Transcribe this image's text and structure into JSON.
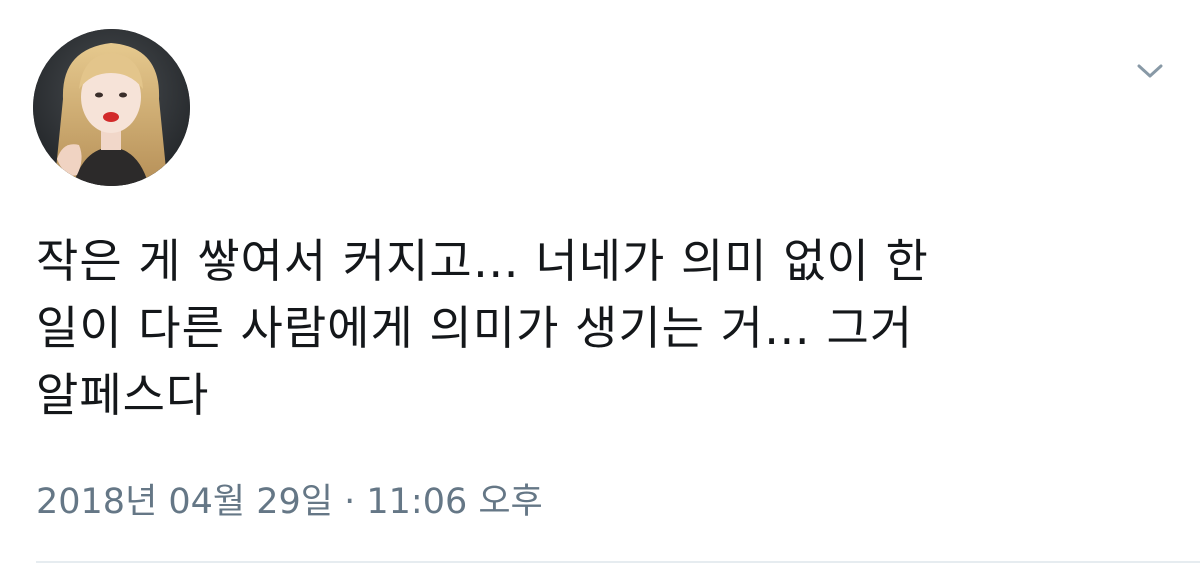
{
  "tweet": {
    "avatar_icon": "user-avatar",
    "menu_icon": "chevron-down-icon",
    "text": "작은 게 쌓여서 커지고… 너네가 의미 없이 한\n일이 다른 사람에게 의미가 생기는 거… 그거\n알페스다",
    "timestamp": "2018년 04월 29일 · 11:06 오후"
  },
  "colors": {
    "text": "#14171a",
    "meta": "#657786",
    "chevron": "#8899a6",
    "divider": "#e6ecf0"
  }
}
